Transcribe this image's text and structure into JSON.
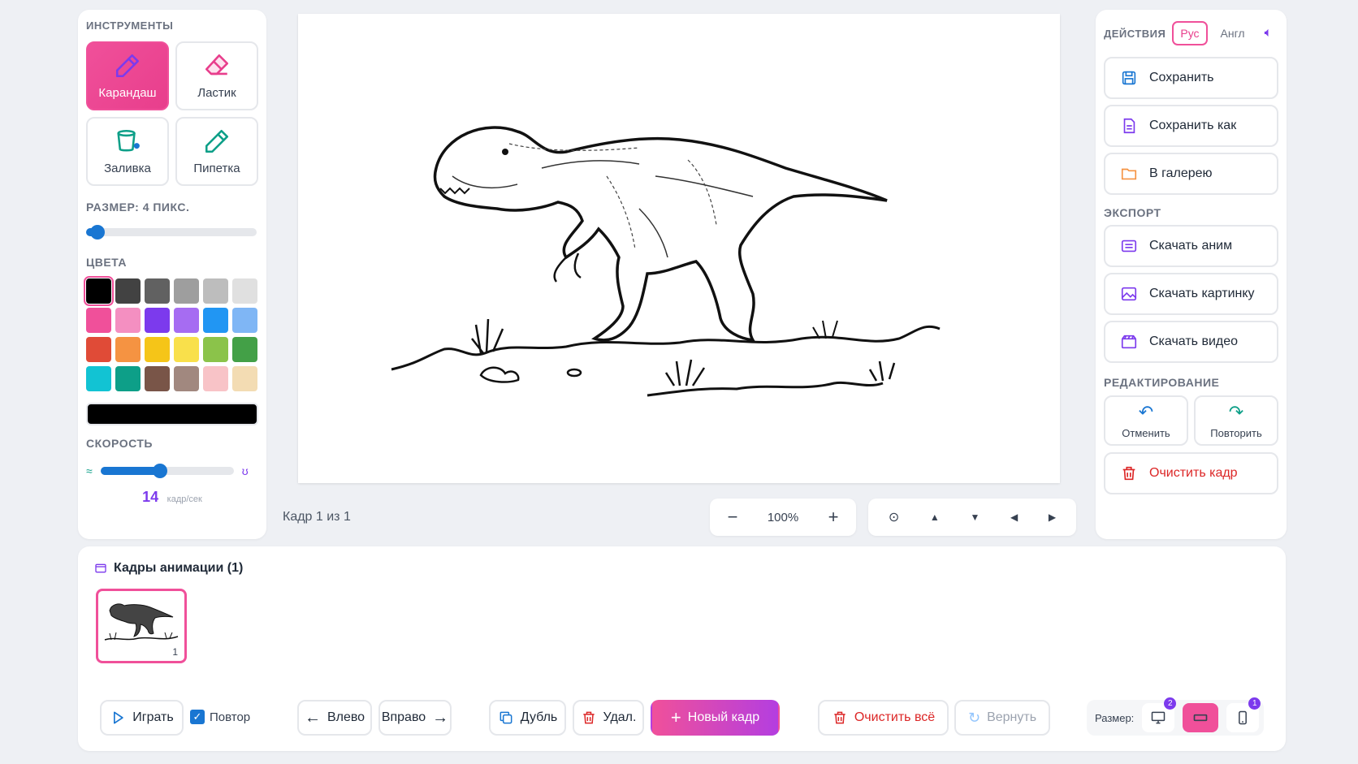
{
  "tools": {
    "title": "ИНСТРУМЕНТЫ",
    "pencil": "Карандаш",
    "eraser": "Ластик",
    "fill": "Заливка",
    "picker": "Пипетка"
  },
  "size": {
    "label": "РАЗМЕР: 4 ПИКС.",
    "value": 4
  },
  "colors": {
    "title": "ЦВЕТА",
    "palette": [
      "#000000",
      "#424242",
      "#616161",
      "#9e9e9e",
      "#bdbdbd",
      "#e0e0e0",
      "#f0509a",
      "#f48fc1",
      "#7c3aed",
      "#a66cf2",
      "#2196f3",
      "#7fb6f5",
      "#e04b37",
      "#f59342",
      "#f5c518",
      "#f9e04b",
      "#8bc34a",
      "#43a047",
      "#12c3d3",
      "#0d9f88",
      "#795548",
      "#a1887f",
      "#f8c3c7",
      "#f3dcb3"
    ],
    "selected": "#000000"
  },
  "speed": {
    "title": "СКОРОСТЬ",
    "value": "14",
    "unit": "кадр/сек",
    "fraction": 0.45
  },
  "canvas": {
    "frame_info": "Кадр 1 из 1",
    "zoom": "100%"
  },
  "actions": {
    "title": "ДЕЙСТВИЯ",
    "lang_ru": "Рус",
    "lang_en": "Англ",
    "save": "Сохранить",
    "save_as": "Сохранить как",
    "to_gallery": "В галерею"
  },
  "export": {
    "title": "ЭКСПОРТ",
    "anim": "Скачать аним",
    "image": "Скачать картинку",
    "video": "Скачать видео"
  },
  "edit": {
    "title": "РЕДАКТИРОВАНИЕ",
    "undo": "Отменить",
    "redo": "Повторить",
    "clear_frame": "Очистить кадр"
  },
  "frames": {
    "title": "Кадры анимации (1)",
    "items": [
      {
        "number": "1"
      }
    ]
  },
  "bottom": {
    "play": "Играть",
    "loop": "Повтор",
    "left": "Влево",
    "right": "Вправо",
    "duplicate": "Дубль",
    "delete": "Удал.",
    "new_frame": "Новый кадр",
    "clear_all": "Очистить всё",
    "restore": "Вернуть",
    "size_label": "Размер:",
    "badge_desktop": "2",
    "badge_mobile": "1"
  },
  "accent": "#f0509a"
}
